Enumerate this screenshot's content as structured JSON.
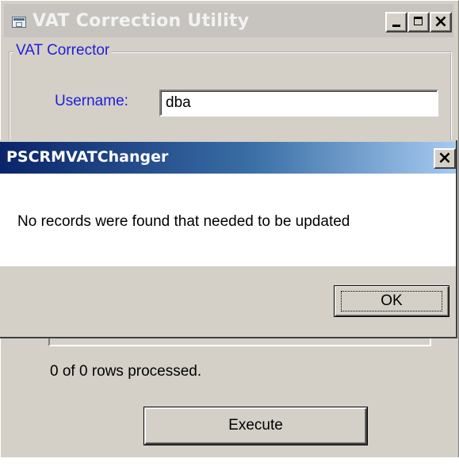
{
  "main_window": {
    "title": "VAT Correction Utility",
    "icon": "app-window-icon",
    "controls": [
      "minimize-icon",
      "maximize-icon",
      "close-icon"
    ],
    "controls_glyphs": {
      "close": "×"
    },
    "group_label": "VAT Corrector",
    "username_label": "Username:",
    "username_value": "dba",
    "rows_processed": "0 of 0 rows processed.",
    "execute_label": "Execute"
  },
  "dialog": {
    "title": "PSCRMVATChanger",
    "close_glyph": "×",
    "message": "No records were found that needed to be updated",
    "ok_label": "OK"
  },
  "colors": {
    "face": "#d4d0c8",
    "label_blue": "#2020d8",
    "title_gradient_start": "#0a246a",
    "title_gradient_end": "#a6caf0"
  }
}
